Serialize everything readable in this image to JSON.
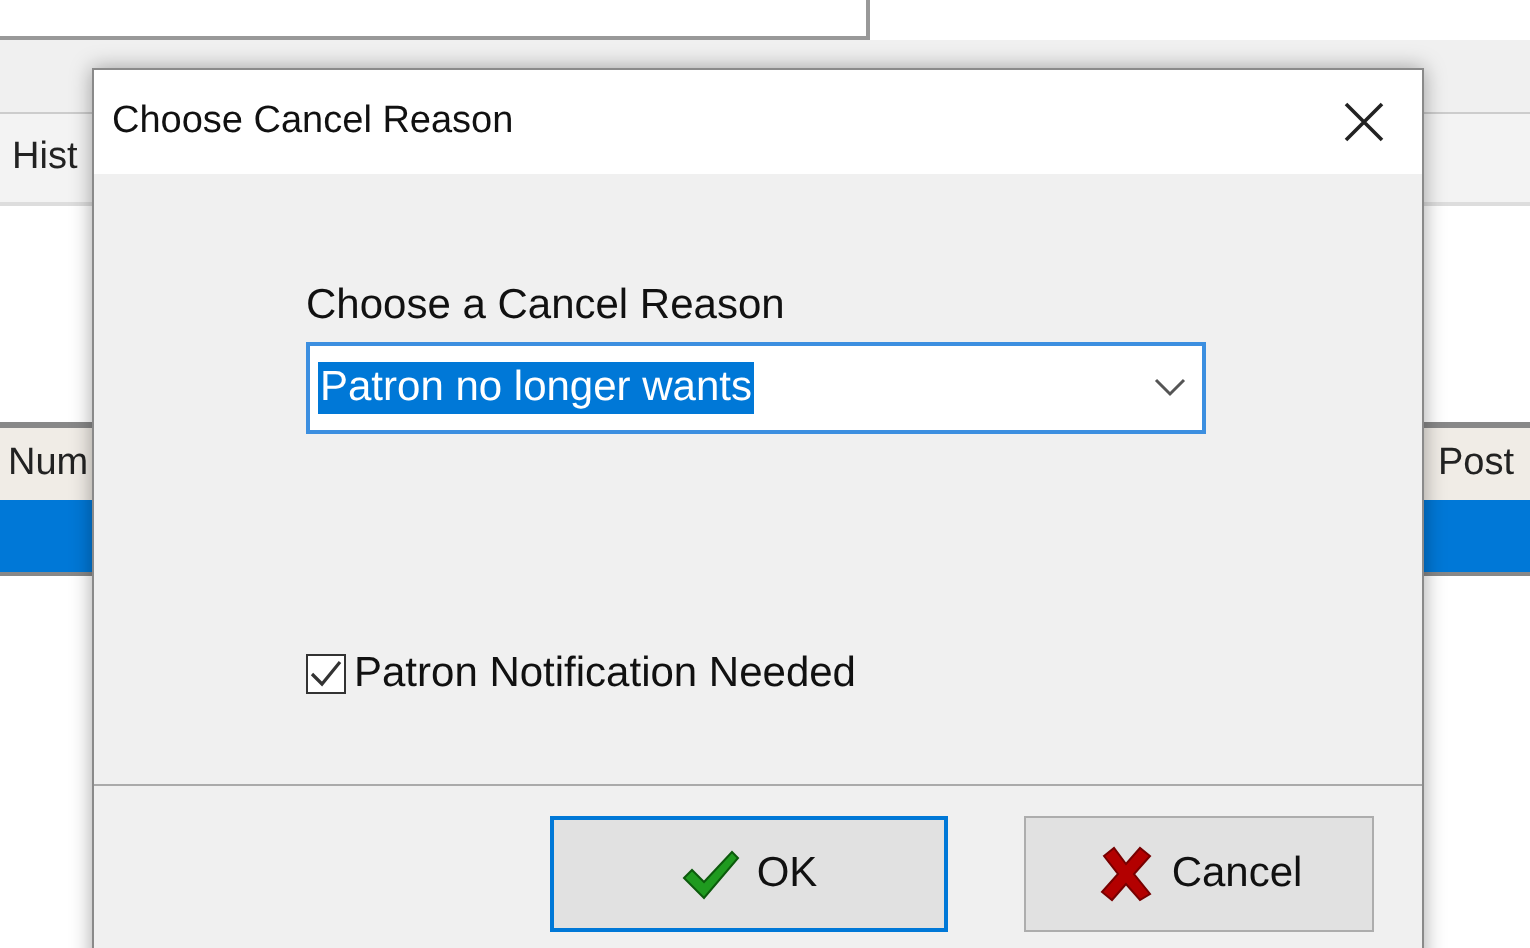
{
  "background": {
    "tab_label": "Hist",
    "table": {
      "columns": [
        "Num",
        "Post"
      ],
      "rows": [
        {
          "selected": true
        }
      ]
    }
  },
  "dialog": {
    "title": "Choose Cancel Reason",
    "reason_label": "Choose a Cancel Reason",
    "reason_combo": {
      "value": "Patron no longer wants",
      "focused": true
    },
    "notification_checkbox": {
      "label": "Patron Notification Needed",
      "checked": true
    },
    "buttons": [
      {
        "kind": "ok",
        "label": "OK",
        "default": true
      },
      {
        "kind": "cancel",
        "label": "Cancel",
        "default": false
      }
    ]
  }
}
